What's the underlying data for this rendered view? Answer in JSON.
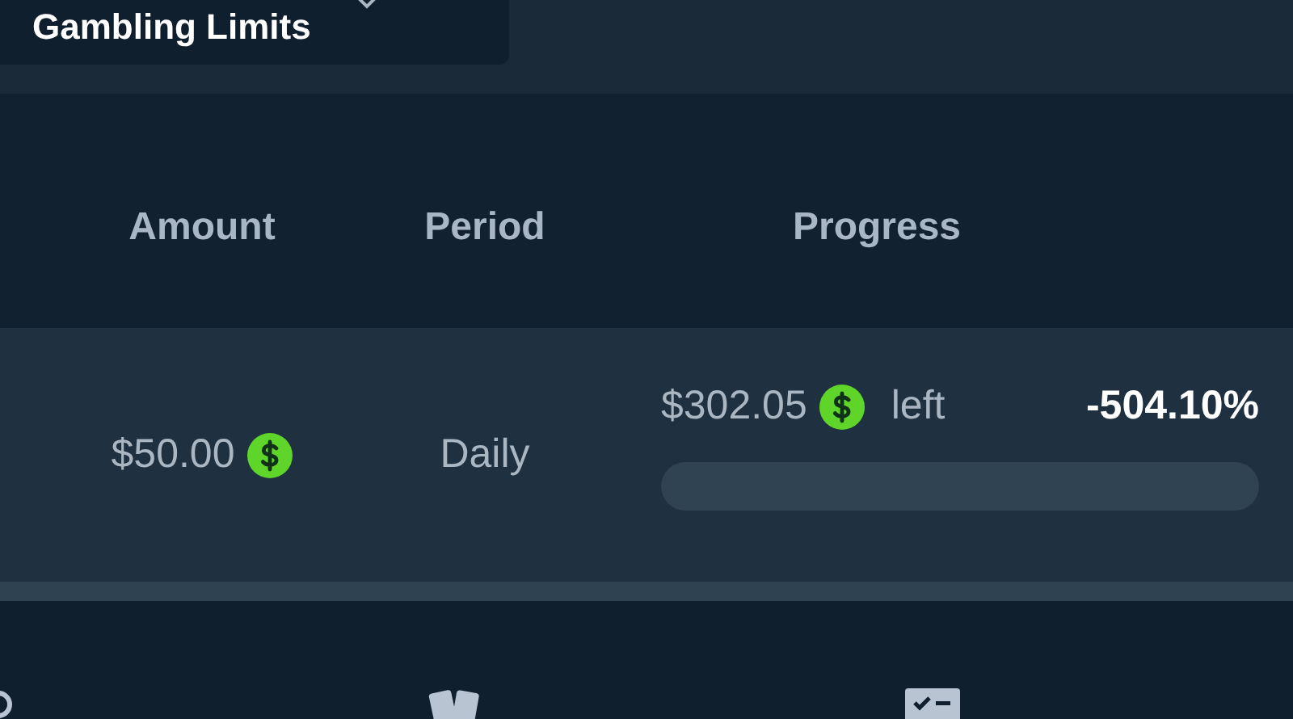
{
  "dropdown": {
    "label": "Gambling Limits"
  },
  "table": {
    "columns": [
      "Amount",
      "Period",
      "Progress"
    ],
    "rows": [
      {
        "amount": "$50.00",
        "period": "Daily",
        "remaining": "$302.05",
        "remaining_suffix": "left",
        "percent": "-504.10%",
        "level": 0
      }
    ]
  }
}
